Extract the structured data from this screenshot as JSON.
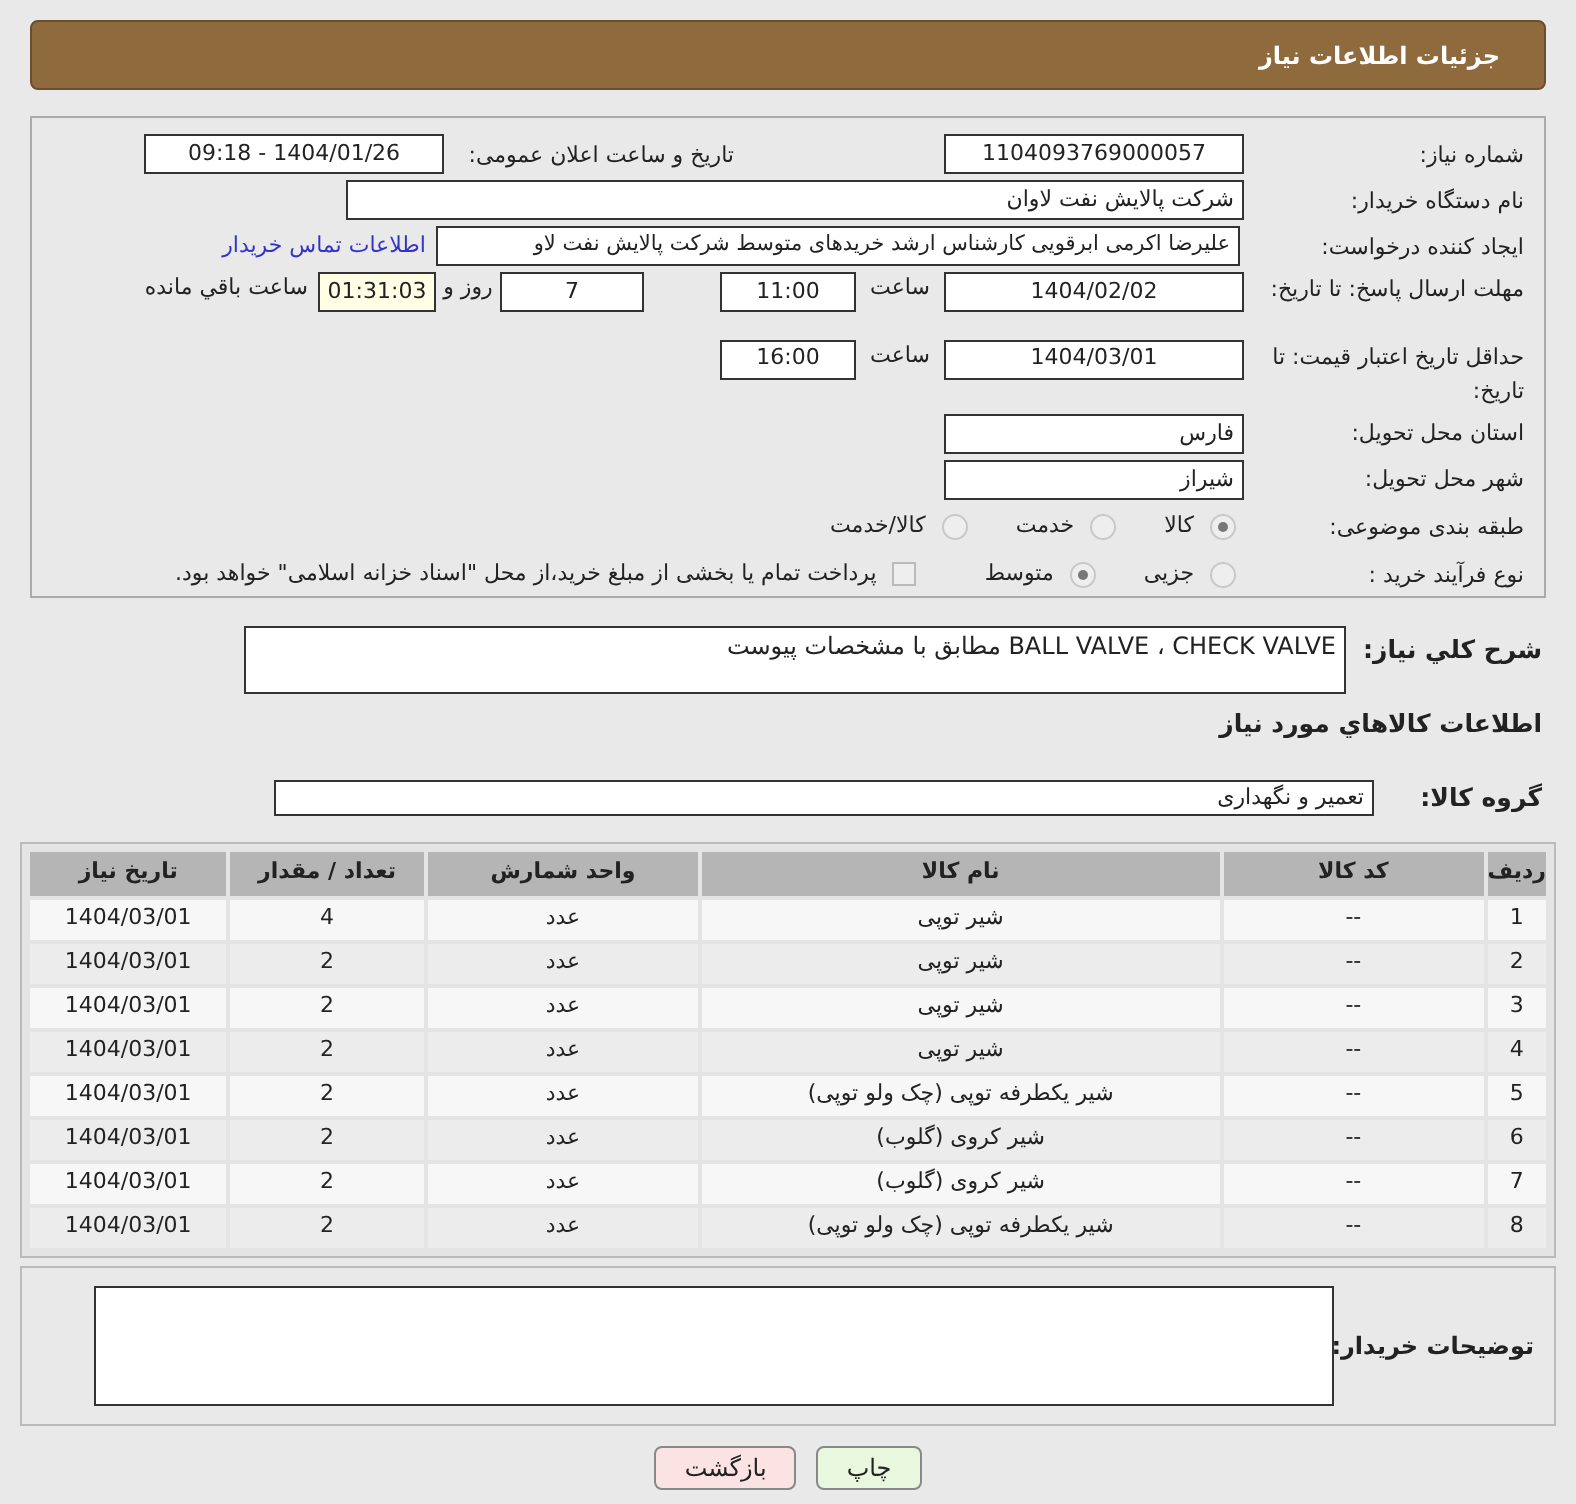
{
  "title": "جزئیات اطلاعات نیاز",
  "need_number": {
    "label": "شماره نیاز:",
    "value": "1104093769000057"
  },
  "announce": {
    "label": "تاریخ و ساعت اعلان عمومی:",
    "value": "1404/01/26 - 09:18"
  },
  "buyer_org": {
    "label": "نام دستگاه خریدار:",
    "value": "شرکت پالایش نفت لاوان"
  },
  "creator": {
    "label": "ایجاد کننده درخواست:",
    "value": "علیرضا اکرمی ابرقویی کارشناس ارشد خریدهای متوسط شرکت پالایش نفت لاو",
    "link": "اطلاعات تماس خریدار"
  },
  "reply_deadline": {
    "label": "مهلت ارسال پاسخ: تا تاریخ:",
    "date": "1404/02/02",
    "time_label": "ساعت",
    "time": "11:00",
    "days": "7",
    "days_label": "روز و",
    "remaining": "01:31:03",
    "remaining_label": "ساعت باقي مانده"
  },
  "price_validity": {
    "label": "حداقل تاریخ اعتبار قیمت: تا تاریخ:",
    "date": "1404/03/01",
    "time_label": "ساعت",
    "time": "16:00"
  },
  "province": {
    "label": "استان محل تحویل:",
    "value": "فارس"
  },
  "city": {
    "label": "شهر محل تحویل:",
    "value": "شیراز"
  },
  "category": {
    "label": "طبقه بندی موضوعی:",
    "options": [
      {
        "label": "کالا",
        "selected": true
      },
      {
        "label": "خدمت",
        "selected": false
      },
      {
        "label": "کالا/خدمت",
        "selected": false
      }
    ]
  },
  "process": {
    "label": "نوع فرآیند خرید :",
    "options": [
      {
        "label": "جزیی",
        "selected": false
      },
      {
        "label": "متوسط",
        "selected": true
      }
    ],
    "payment": {
      "checked": false,
      "text": "پرداخت تمام یا بخشی از مبلغ خرید،از محل \"اسناد خزانه اسلامی\" خواهد بود."
    }
  },
  "description": {
    "label": "شرح كلي نياز:",
    "value": "BALL VALVE ، CHECK VALVE  مطابق با مشخصات پیوست"
  },
  "goods_heading": "اطلاعات كالاهاي مورد نياز",
  "goods_group": {
    "label": "گروه کالا:",
    "value": "تعمیر و نگهداری"
  },
  "table": {
    "columns": [
      "ردیف",
      "کد کالا",
      "نام کالا",
      "واحد شمارش",
      "تعداد / مقدار",
      "تاریخ نیاز"
    ],
    "rows": [
      [
        "1",
        "--",
        "شیر توپی",
        "عدد",
        "4",
        "1404/03/01"
      ],
      [
        "2",
        "--",
        "شیر توپی",
        "عدد",
        "2",
        "1404/03/01"
      ],
      [
        "3",
        "--",
        "شیر توپی",
        "عدد",
        "2",
        "1404/03/01"
      ],
      [
        "4",
        "--",
        "شیر توپی",
        "عدد",
        "2",
        "1404/03/01"
      ],
      [
        "5",
        "--",
        "شیر یکطرفه توپی (چک ولو توپی)",
        "عدد",
        "2",
        "1404/03/01"
      ],
      [
        "6",
        "--",
        "شیر کروی (گلوب)",
        "عدد",
        "2",
        "1404/03/01"
      ],
      [
        "7",
        "--",
        "شیر کروی (گلوب)",
        "عدد",
        "2",
        "1404/03/01"
      ],
      [
        "8",
        "--",
        "شیر یکطرفه توپی (چک ولو توپی)",
        "عدد",
        "2",
        "1404/03/01"
      ]
    ]
  },
  "buyer_notes": {
    "label": "توضیحات خریدار:"
  },
  "buttons": [
    {
      "label": "چاپ",
      "kind": "print"
    },
    {
      "label": "بازگشت",
      "kind": "back"
    }
  ]
}
